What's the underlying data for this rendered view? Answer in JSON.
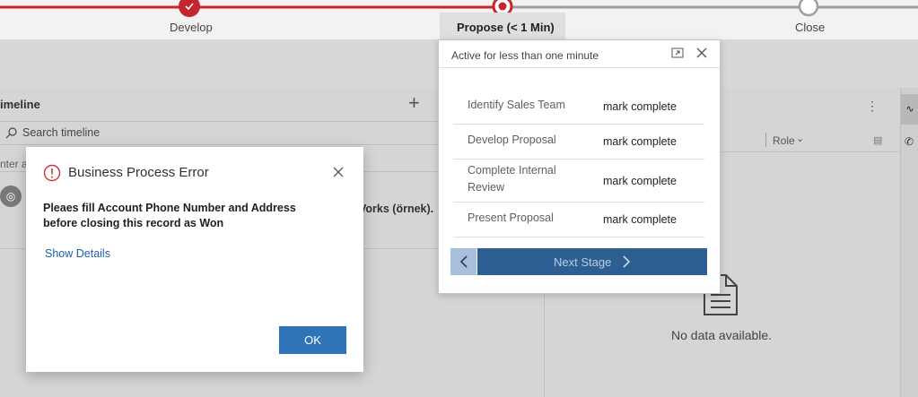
{
  "process": {
    "stages": [
      {
        "label": "Develop",
        "state": "completed"
      },
      {
        "label": "Propose  (< 1 Min)",
        "state": "active"
      },
      {
        "label": "Close",
        "state": "pending"
      }
    ]
  },
  "timeline": {
    "title": "imeline",
    "search_placeholder": "Search timeline",
    "note_placeholder": "nter a",
    "entry_fragment": "Vorks (örnek)."
  },
  "right_panel": {
    "column_role": "Role",
    "empty_text": "No data available."
  },
  "flyout": {
    "status": "Active for less than one minute",
    "steps": [
      {
        "name": "Identify Sales Team",
        "action": "mark complete"
      },
      {
        "name": "Develop Proposal",
        "action": "mark complete"
      },
      {
        "name": "Complete Internal Review",
        "action": "mark complete"
      },
      {
        "name": "Present Proposal",
        "action": "mark complete"
      }
    ],
    "next_stage_label": "Next Stage"
  },
  "dialog": {
    "title": "Business Process Error",
    "message": "Pleaes fill Account Phone Number and Address before closing this record as Won",
    "details_link": "Show Details",
    "ok_label": "OK"
  },
  "colors": {
    "active_stage": "#c4262e",
    "primary_button": "#2f73b8",
    "next_stage_bar": "#2e5f93",
    "error_icon": "#d13438",
    "link": "#1f5fa8"
  }
}
